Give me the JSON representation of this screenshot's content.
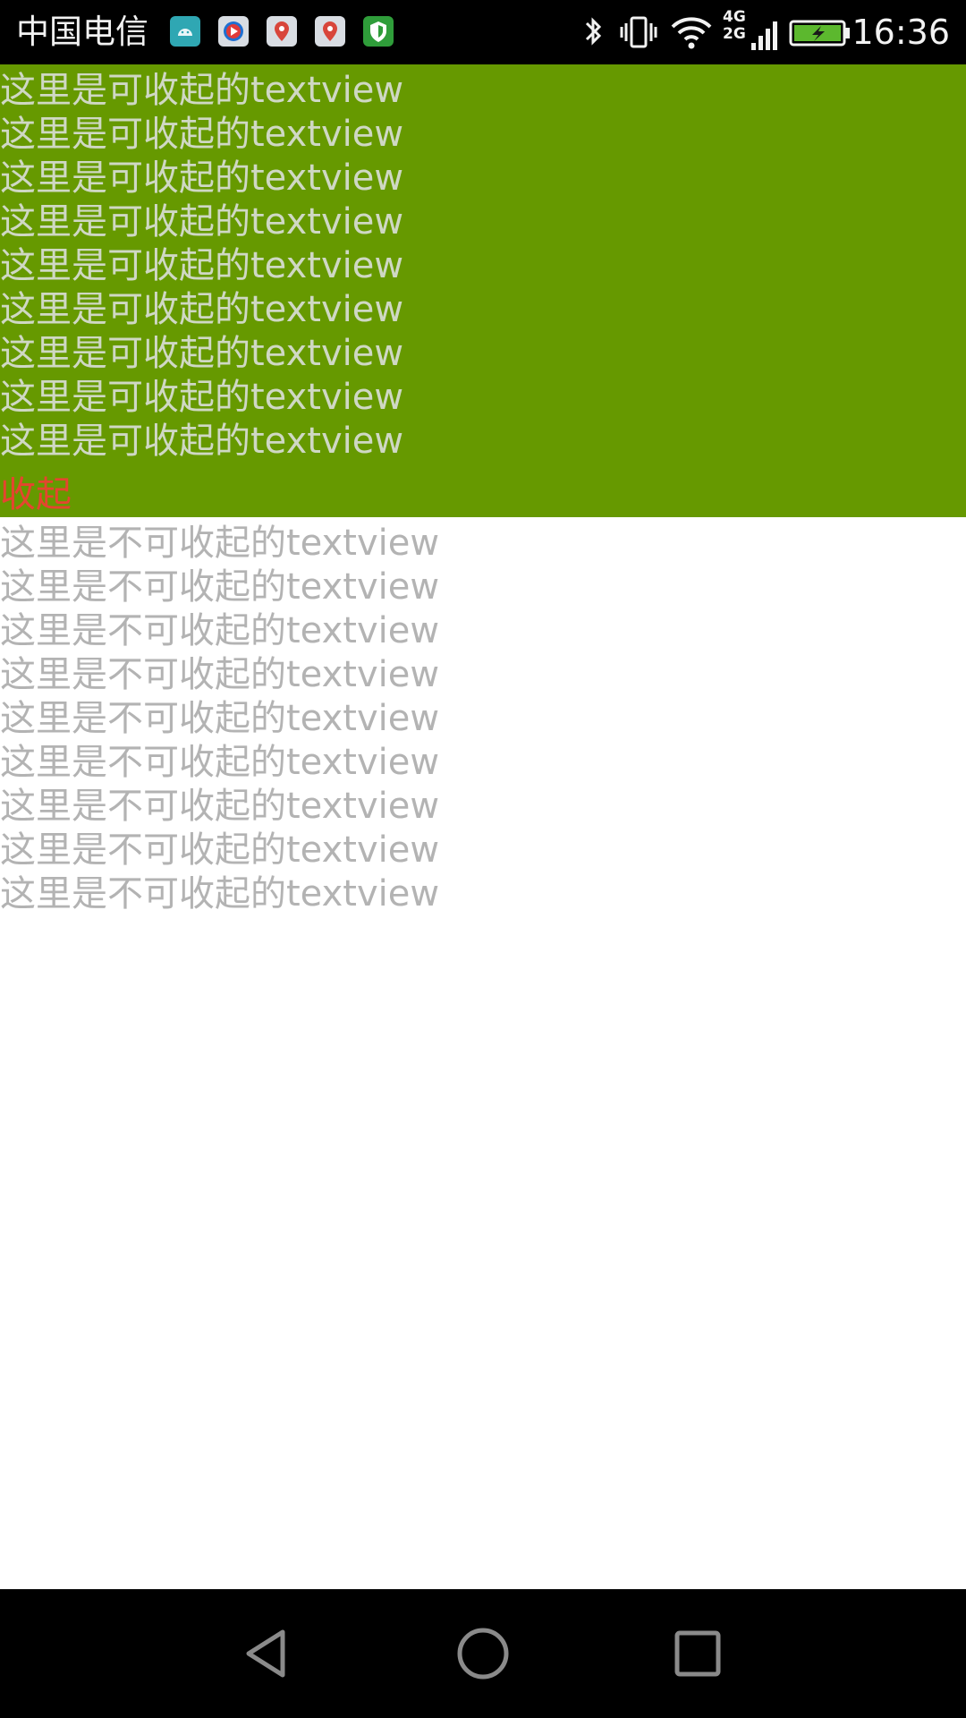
{
  "status_bar": {
    "carrier": "中国电信",
    "network_label_top": "4G",
    "network_label_bottom": "2G",
    "time": "16:36",
    "icons": [
      "android-notification-icon",
      "video-app-icon",
      "map-app-icon",
      "map-app-icon",
      "security-shield-icon",
      "bluetooth-icon",
      "vibrate-icon",
      "wifi-icon",
      "signal-icon",
      "battery-charging-icon"
    ]
  },
  "collapsible_section": {
    "background_color": "#669900",
    "lines": [
      "这里是可收起的textview",
      "这里是可收起的textview",
      "这里是可收起的textview",
      "这里是可收起的textview",
      "这里是可收起的textview",
      "这里是可收起的textview",
      "这里是可收起的textview",
      "这里是可收起的textview",
      "这里是可收起的textview"
    ],
    "collapse_label": "收起",
    "collapse_color": "#e5452f"
  },
  "fixed_section": {
    "lines": [
      "这里是不可收起的textview",
      "这里是不可收起的textview",
      "这里是不可收起的textview",
      "这里是不可收起的textview",
      "这里是不可收起的textview",
      "这里是不可收起的textview",
      "这里是不可收起的textview",
      "这里是不可收起的textview",
      "这里是不可收起的textview"
    ]
  },
  "nav_bar": {
    "buttons": [
      "back-icon",
      "home-icon",
      "recent-apps-icon"
    ]
  }
}
